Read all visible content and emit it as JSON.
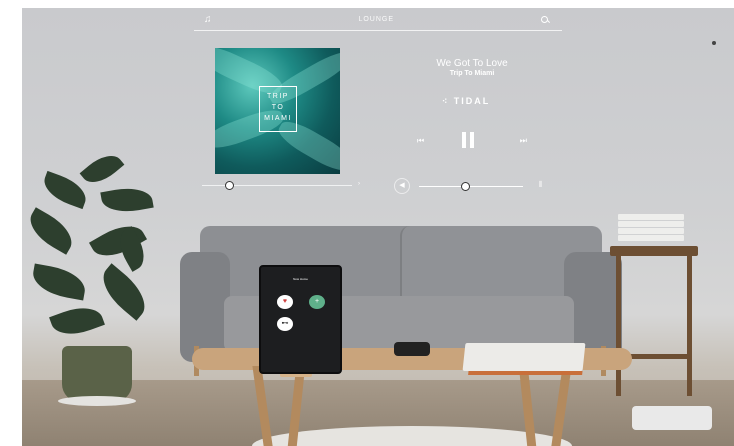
{
  "top_bar": {
    "title": "LOUNGE"
  },
  "album": {
    "line1": "TRIP",
    "line2": "TO",
    "line3": "MIAMI"
  },
  "track": {
    "title": "We Got To Love",
    "artist": "Trip To Miami"
  },
  "service": {
    "name": "TIDAL"
  },
  "playback": {
    "progress_fraction": 0.18,
    "volume_fraction": 0.45
  },
  "tablet": {
    "header": "Now Home"
  },
  "icons": {
    "music": "music-note-icon",
    "search": "search-icon",
    "prev": "skip-previous-icon",
    "pause": "pause-icon",
    "next": "skip-next-icon",
    "volume": "speaker-icon",
    "level": "volume-level-icon"
  }
}
